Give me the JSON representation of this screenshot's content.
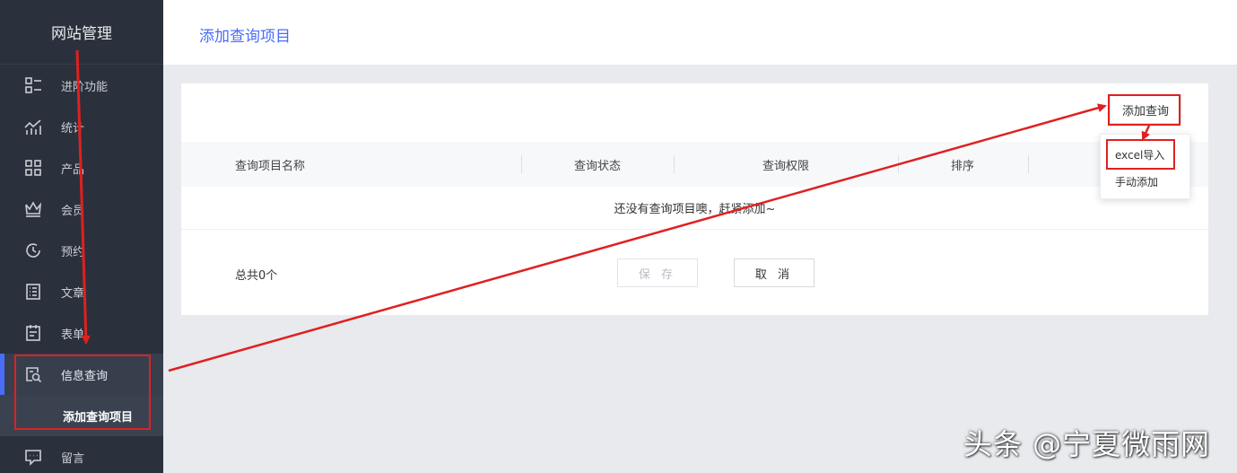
{
  "sidebar": {
    "brand": "网站管理",
    "items": [
      {
        "label": "进阶功能",
        "icon": "advanced-features-icon"
      },
      {
        "label": "统计",
        "icon": "statistics-icon"
      },
      {
        "label": "产品",
        "icon": "products-icon"
      },
      {
        "label": "会员",
        "icon": "crown-icon"
      },
      {
        "label": "预约",
        "icon": "clock-icon"
      },
      {
        "label": "文章",
        "icon": "article-icon"
      },
      {
        "label": "表单",
        "icon": "form-icon"
      },
      {
        "label": "信息查询",
        "icon": "info-search-icon"
      }
    ],
    "sub_item": "添加查询项目",
    "last_item": {
      "label": "留言",
      "icon": "message-icon"
    }
  },
  "header": {
    "title": "添加查询项目"
  },
  "main": {
    "add_button": "添加查询",
    "columns": [
      "查询项目名称",
      "查询状态",
      "查询权限",
      "排序"
    ],
    "empty_text": "还没有查询项目噢，赶紧添加~",
    "total_text": "总共0个",
    "save_label": "保 存",
    "cancel_label": "取 消"
  },
  "dropdown": {
    "items": [
      "excel导入",
      "手动添加"
    ]
  },
  "watermark": "头条 @宁夏微雨网",
  "colors": {
    "sidebar_bg": "#2b313c",
    "accent": "#4a6cf7",
    "annotation": "#e02020"
  }
}
